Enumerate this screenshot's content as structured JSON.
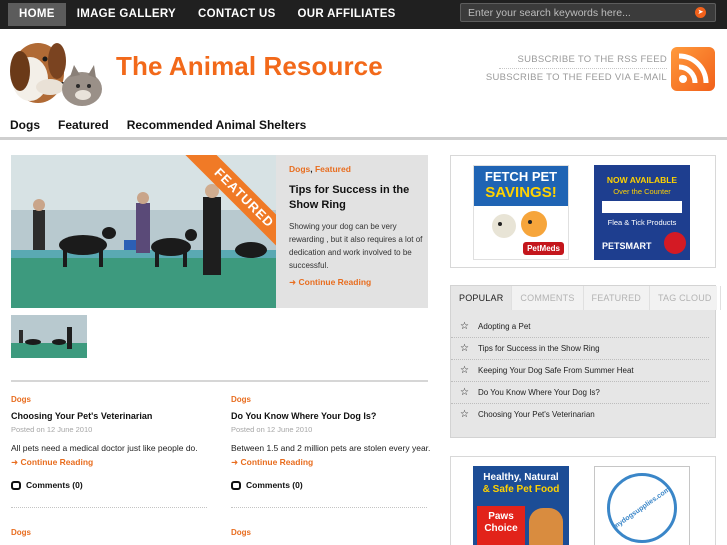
{
  "topnav": {
    "items": [
      {
        "label": "HOME",
        "active": true
      },
      {
        "label": "IMAGE GALLERY",
        "active": false
      },
      {
        "label": "CONTACT US",
        "active": false
      },
      {
        "label": "OUR AFFILIATES",
        "active": false
      }
    ]
  },
  "search": {
    "placeholder": "Enter your search keywords here...",
    "button_icon": "arrow-right-icon"
  },
  "header": {
    "title": "The Animal Resource",
    "subscribe_rss": "SUBSCRIBE TO THE RSS FEED",
    "subscribe_email": "SUBSCRIBE TO THE FEED VIA E-MAIL",
    "rss_icon": "rss-icon"
  },
  "categories": {
    "items": [
      "Dogs",
      "Featured",
      "Recommended Animal Shelters"
    ]
  },
  "featured": {
    "ribbon": "FEATURED",
    "cat1": "Dogs",
    "cat_sep": ", ",
    "cat2": "Featured",
    "title": "Tips for Success in the Show Ring",
    "excerpt": "Showing your dog can be very rewarding , but it also requires a lot of dedication and work involved to be successful.",
    "more": "Continue Reading"
  },
  "posts": [
    {
      "category": "Dogs",
      "title": "Choosing Your Pet's Veterinarian",
      "date": "Posted on 12 June 2010",
      "excerpt": "All pets need a medical doctor just like people do.",
      "more": "Continue Reading",
      "comments": "Comments (0)"
    },
    {
      "category": "Dogs",
      "title": "Do You Know Where Your Dog Is?",
      "date": "Posted on 12 June 2010",
      "excerpt": "Between 1.5 and 2 million pets are stolen every year.",
      "more": "Continue Reading",
      "comments": "Comments (0)"
    }
  ],
  "posts_row2": [
    {
      "category": "Dogs"
    },
    {
      "category": "Dogs"
    }
  ],
  "sidebar": {
    "ads_top": [
      {
        "line1": "FETCH PET",
        "line2": "SAVINGS!",
        "brand": "PetMeds"
      },
      {
        "line1": "NOW AVAILABLE",
        "line2": "Over the Counter",
        "line3": "Flea & Tick Products",
        "brand": "PETSMART"
      }
    ],
    "tabs": [
      {
        "label": "POPULAR",
        "active": true
      },
      {
        "label": "COMMENTS",
        "active": false
      },
      {
        "label": "FEATURED",
        "active": false
      },
      {
        "label": "TAG CLOUD",
        "active": false
      }
    ],
    "popular": [
      "Adopting a Pet",
      "Tips for Success in the Show Ring",
      "Keeping Your Dog Safe From Summer Heat",
      "Do You Know Where Your Dog Is?",
      "Choosing Your Pet's Veterinarian"
    ],
    "ads_bottom": [
      {
        "line1": "Healthy, Natural",
        "line2": "& Safe Pet Food",
        "brand": "Paws Choice"
      },
      {
        "brand": "mydogsupplies.com"
      }
    ]
  },
  "colors": {
    "accent": "#f2691a",
    "topbar": "#202020",
    "tab_bg": "#e6e6e6"
  }
}
